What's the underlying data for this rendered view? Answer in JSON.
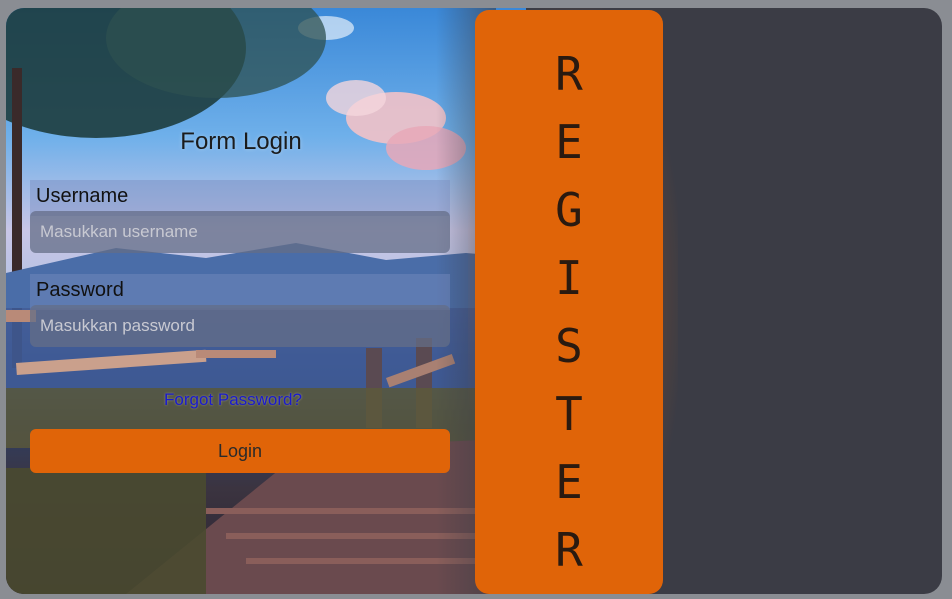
{
  "login": {
    "title": "Form Login",
    "username_label": "Username",
    "username_placeholder": "Masukkan username",
    "password_label": "Password",
    "password_placeholder": "Masukkan password",
    "forgot_link": "Forgot Password?",
    "login_button": "Login"
  },
  "register": {
    "letters": [
      "R",
      "E",
      "G",
      "I",
      "S",
      "T",
      "E",
      "R"
    ]
  },
  "colors": {
    "accent": "#e06408",
    "panel_bg": "#3b3c45",
    "link": "#1a1acc"
  }
}
